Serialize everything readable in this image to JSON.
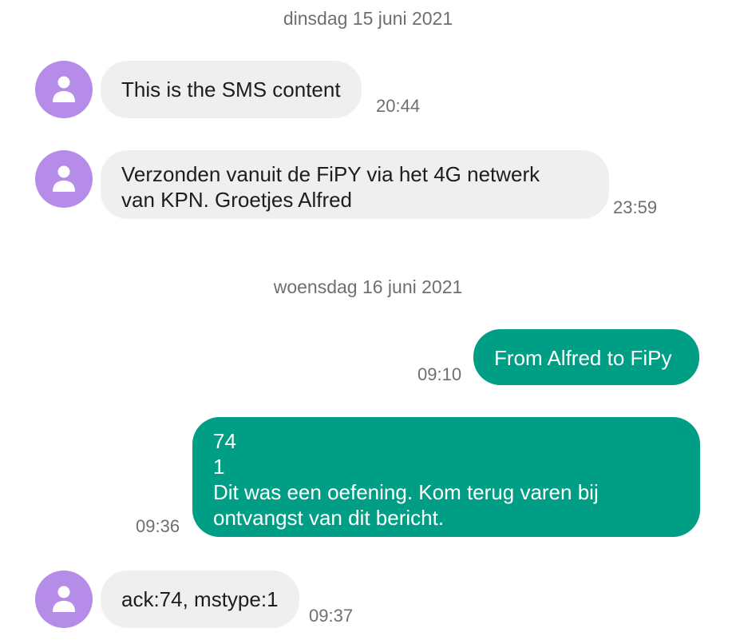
{
  "colors": {
    "incoming_bubble": "#efefef",
    "outgoing_bubble": "#009e85",
    "avatar": "#b58ce8",
    "timestamp": "#6f6f6f"
  },
  "days": [
    {
      "date": "dinsdag 15 juni 2021",
      "messages": [
        {
          "direction": "incoming",
          "avatar_icon": "person-icon",
          "text": "This is the SMS content",
          "time": "20:44"
        },
        {
          "direction": "incoming",
          "avatar_icon": "person-icon",
          "text": "Verzonden vanuit de FiPY via het 4G netwerk\nvan KPN. Groetjes Alfred",
          "time": "23:59"
        }
      ]
    },
    {
      "date": "woensdag 16 juni 2021",
      "messages": [
        {
          "direction": "outgoing",
          "text": "From Alfred to FiPy",
          "time": "09:10"
        },
        {
          "direction": "outgoing",
          "text": "74\n1\nDit was een oefening. Kom terug varen bij\nontvangst van dit bericht.",
          "time": "09:36"
        },
        {
          "direction": "incoming",
          "avatar_icon": "person-icon",
          "text": "ack:74, mstype:1",
          "time": "09:37"
        }
      ]
    }
  ]
}
